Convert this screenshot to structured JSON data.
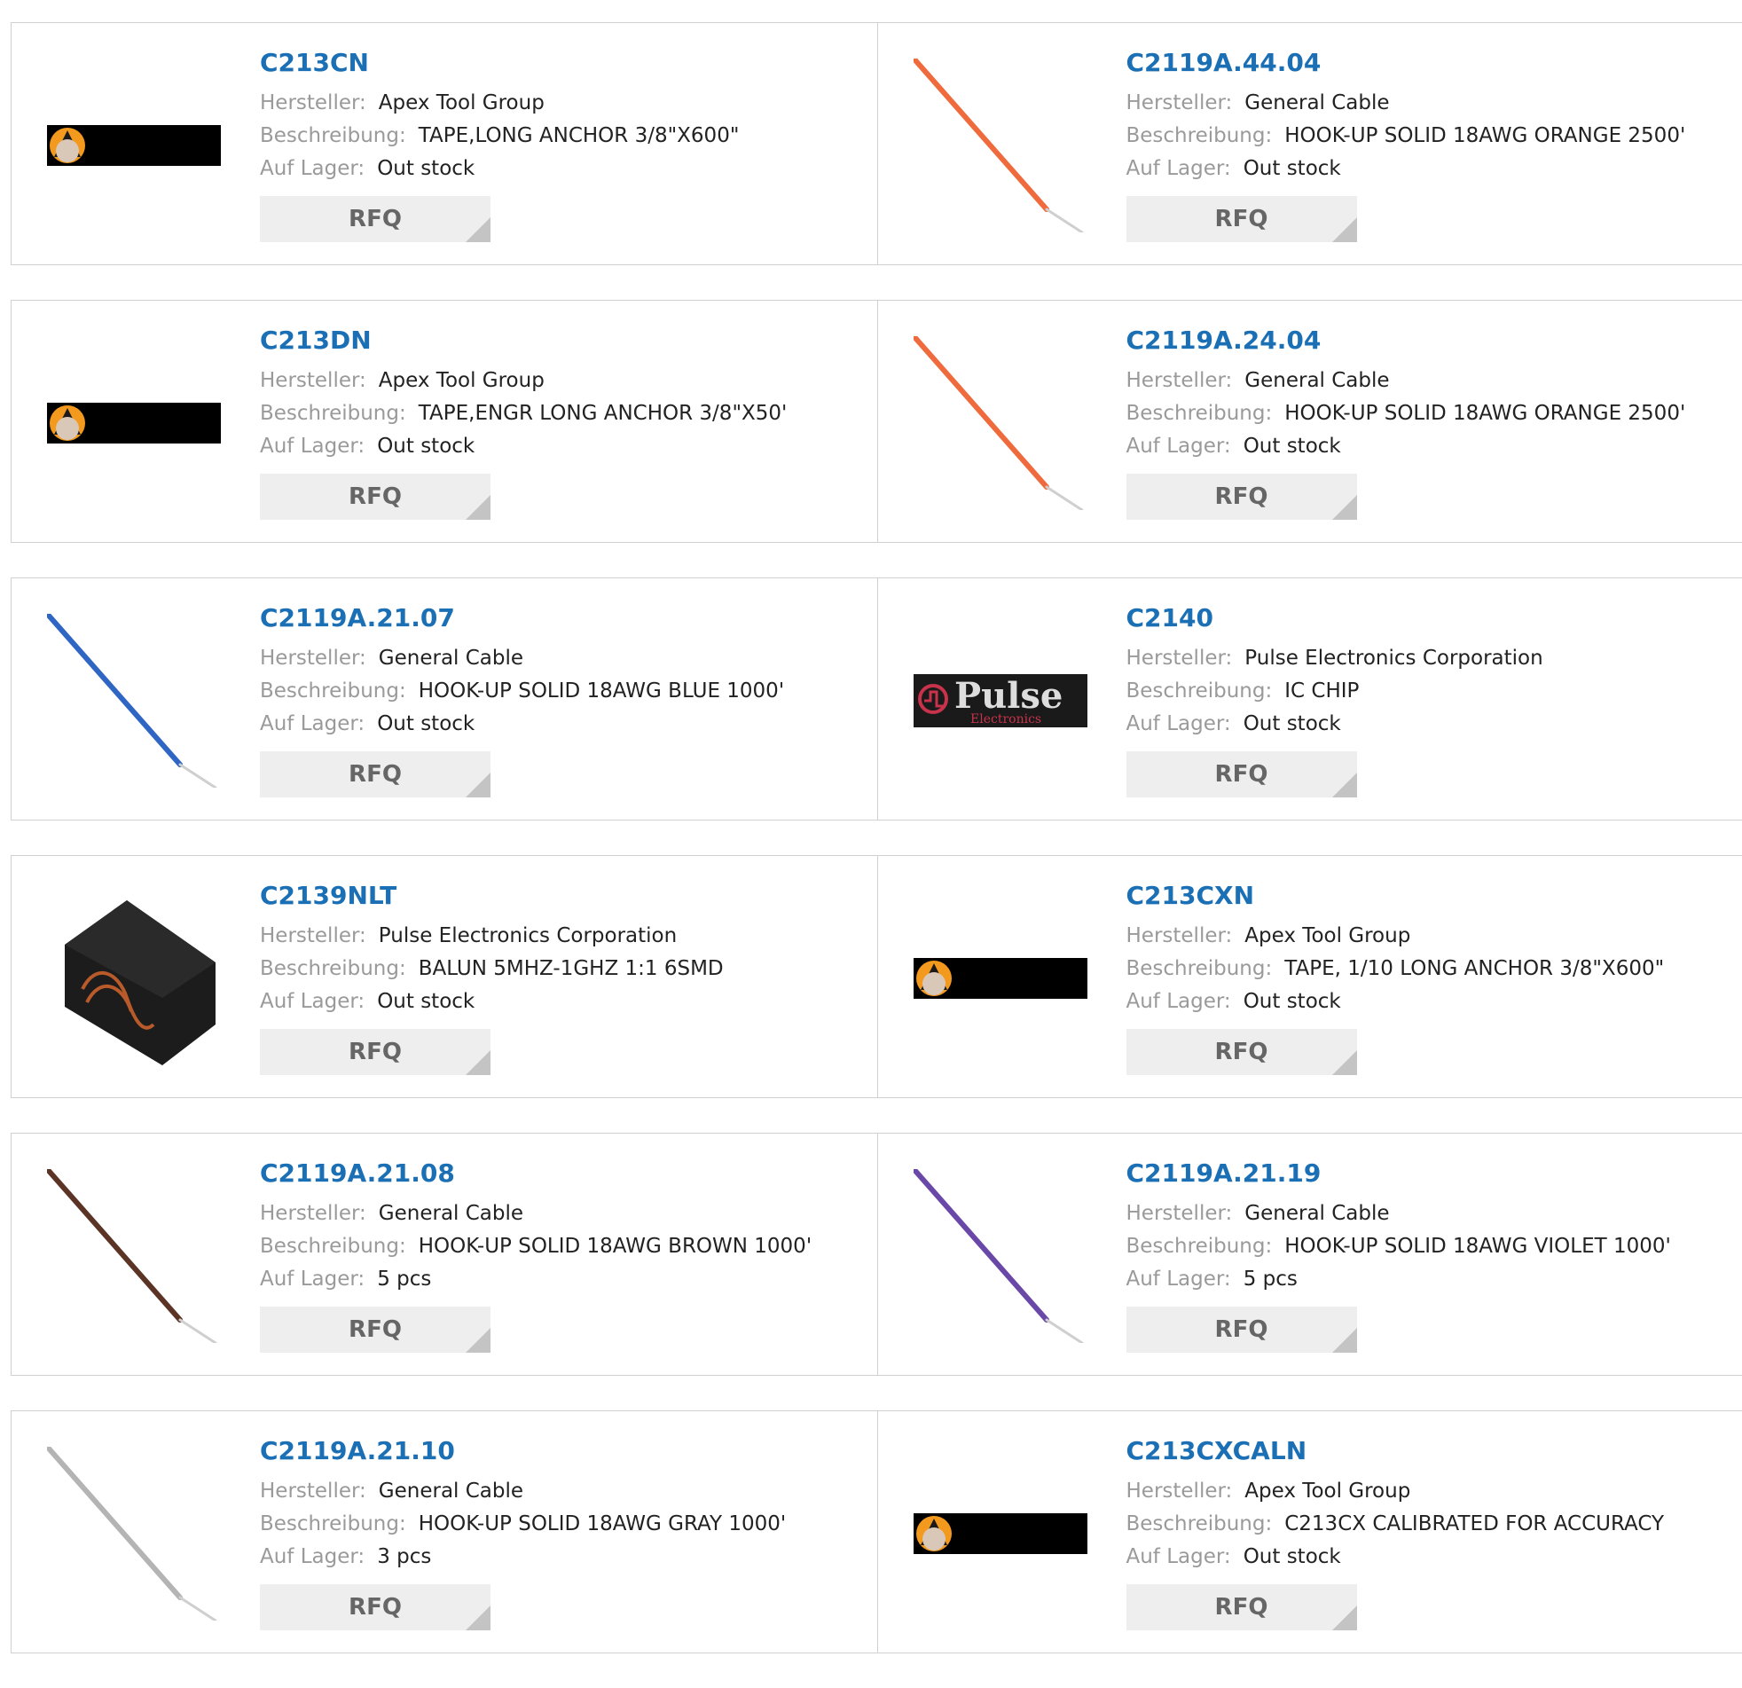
{
  "labels": {
    "manufacturer": "Hersteller:",
    "description": "Beschreibung:",
    "stock": "Auf Lager:",
    "rfq": "RFQ"
  },
  "colors": {
    "part_link": "#1a6fb5",
    "label": "#9a9a9a",
    "value": "#222222",
    "rfq_bg": "#eeeeee",
    "rfq_text": "#666666"
  },
  "products": [
    {
      "part": "C213CN",
      "manufacturer": "Apex Tool Group",
      "description": "TAPE,LONG ANCHOR 3/8\"X600\"",
      "stock": "Out stock",
      "image": "apex-logo",
      "image_color": "#000000"
    },
    {
      "part": "C2119A.44.04",
      "manufacturer": "General Cable",
      "description": "HOOK-UP SOLID 18AWG ORANGE 2500'",
      "stock": "Out stock",
      "image": "wire",
      "image_color": "#ef6a3c"
    },
    {
      "part": "C213DN",
      "manufacturer": "Apex Tool Group",
      "description": "TAPE,ENGR LONG ANCHOR 3/8\"X50'",
      "stock": "Out stock",
      "image": "apex-logo",
      "image_color": "#000000"
    },
    {
      "part": "C2119A.24.04",
      "manufacturer": "General Cable",
      "description": "HOOK-UP SOLID 18AWG ORANGE 2500'",
      "stock": "Out stock",
      "image": "wire",
      "image_color": "#ef6a3c"
    },
    {
      "part": "C2119A.21.07",
      "manufacturer": "General Cable",
      "description": "HOOK-UP SOLID 18AWG BLUE 1000'",
      "stock": "Out stock",
      "image": "wire",
      "image_color": "#2f66c4"
    },
    {
      "part": "C2140",
      "manufacturer": "Pulse Electronics Corporation",
      "description": "IC CHIP",
      "stock": "Out stock",
      "image": "pulse-logo",
      "image_color": "#1a1a1a"
    },
    {
      "part": "C2139NLT",
      "manufacturer": "Pulse Electronics Corporation",
      "description": "BALUN 5MHZ-1GHZ 1:1 6SMD",
      "stock": "Out stock",
      "image": "balun",
      "image_color": "#1c1c1c"
    },
    {
      "part": "C213CXN",
      "manufacturer": "Apex Tool Group",
      "description": "TAPE, 1/10 LONG ANCHOR 3/8\"X600\"",
      "stock": "Out stock",
      "image": "apex-logo",
      "image_color": "#000000"
    },
    {
      "part": "C2119A.21.08",
      "manufacturer": "General Cable",
      "description": "HOOK-UP SOLID 18AWG BROWN 1000'",
      "stock": "5 pcs",
      "image": "wire",
      "image_color": "#5c3426"
    },
    {
      "part": "C2119A.21.19",
      "manufacturer": "General Cable",
      "description": "HOOK-UP SOLID 18AWG VIOLET 1000'",
      "stock": "5 pcs",
      "image": "wire",
      "image_color": "#6a48a8"
    },
    {
      "part": "C2119A.21.10",
      "manufacturer": "General Cable",
      "description": "HOOK-UP SOLID 18AWG GRAY 1000'",
      "stock": "3 pcs",
      "image": "wire",
      "image_color": "#b4b4b4"
    },
    {
      "part": "C213CXCALN",
      "manufacturer": "Apex Tool Group",
      "description": "C213CX CALIBRATED FOR ACCURACY",
      "stock": "Out stock",
      "image": "apex-logo",
      "image_color": "#000000"
    }
  ]
}
